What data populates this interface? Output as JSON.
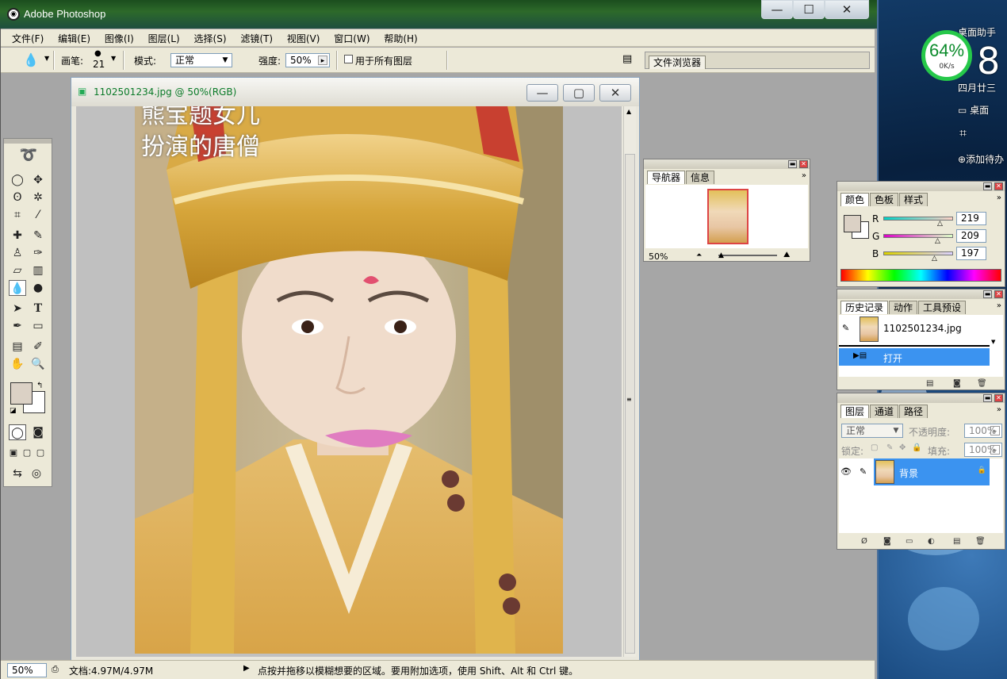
{
  "app": {
    "title": "Adobe Photoshop",
    "title_buttons": [
      "—",
      "☐",
      "✕"
    ]
  },
  "menu": [
    "文件(F)",
    "编辑(E)",
    "图像(I)",
    "图层(L)",
    "选择(S)",
    "滤镜(T)",
    "视图(V)",
    "窗口(W)",
    "帮助(H)"
  ],
  "options": {
    "brush_label": "画笔:",
    "brush_size": "21",
    "mode_label": "模式:",
    "mode_value": "正常",
    "strength_label": "强度:",
    "strength_value": "50%",
    "all_layers_label": "用于所有图层",
    "file_browser_tab": "文件浏览器"
  },
  "document": {
    "title": "1102501234.jpg @ 50%(RGB)",
    "caption_line1": "熊宝题女儿",
    "caption_line2": "扮演的唐僧"
  },
  "status": {
    "zoom": "50%",
    "doc_info": "文档:4.97M/4.97M",
    "hint": "点按并拖移以模糊想要的区域。要用附加选项，使用 Shift、Alt 和 Ctrl 键。"
  },
  "navigator": {
    "tabs": [
      "导航器",
      "信息"
    ],
    "zoom": "50%"
  },
  "color": {
    "tabs": [
      "颜色",
      "色板",
      "样式"
    ],
    "r_label": "R",
    "g_label": "G",
    "b_label": "B",
    "r": "219",
    "g": "209",
    "b": "197",
    "fg_color": "#dbd1c5"
  },
  "history": {
    "tabs": [
      "历史记录",
      "动作",
      "工具预设"
    ],
    "snapshot": "1102501234.jpg",
    "step": "打开"
  },
  "layers": {
    "tabs": [
      "图层",
      "通道",
      "路径"
    ],
    "blend": "正常",
    "opacity_label": "不透明度:",
    "opacity": "100%",
    "lock_label": "锁定:",
    "fill_label": "填充:",
    "fill": "100%",
    "layer_name": "背景"
  },
  "desktop": {
    "gauge_pct": "64%",
    "gauge_speed": "0K/s",
    "widget_title": "桌面助手",
    "big_digit": "8",
    "date": "四月廿三",
    "desktop_label": "桌面",
    "add_label": "添加待办"
  }
}
